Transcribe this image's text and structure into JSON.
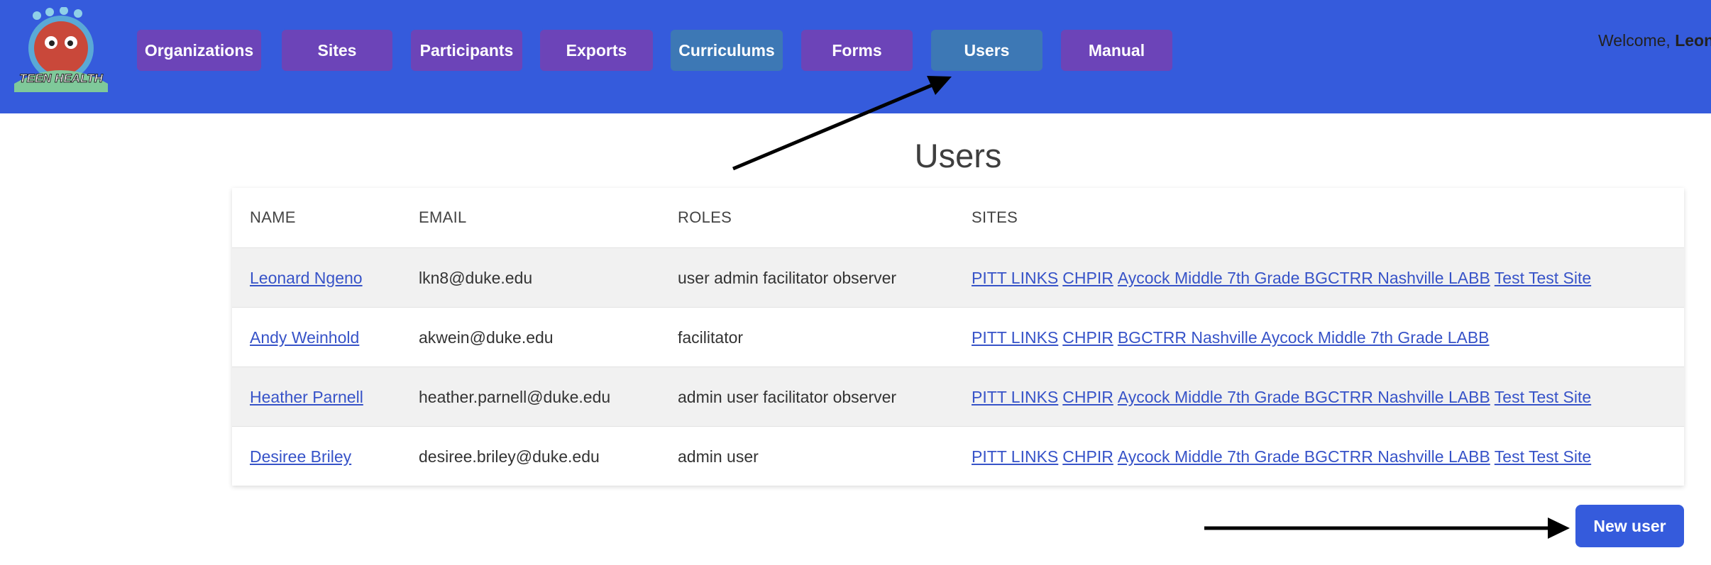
{
  "header": {
    "logo_text": "TEEN HEALTH",
    "nav": [
      {
        "label": "Organizations"
      },
      {
        "label": "Sites"
      },
      {
        "label": "Participants"
      },
      {
        "label": "Exports"
      },
      {
        "label": "Curriculums"
      },
      {
        "label": "Forms"
      },
      {
        "label": "Users",
        "active": true
      },
      {
        "label": "Manual"
      }
    ],
    "welcome_prefix": "Welcome, ",
    "welcome_name": "Leon"
  },
  "colors": {
    "header_bg": "#355bdc",
    "nav_bg": "#6c44b8",
    "nav_active_bg": "#3d78b5",
    "link": "#3753c8",
    "primary_button": "#355bdc"
  },
  "page": {
    "title": "Users"
  },
  "table": {
    "columns": [
      "NAME",
      "EMAIL",
      "ROLES",
      "SITES"
    ],
    "rows": [
      {
        "name": "Leonard Ngeno",
        "email": "lkn8@duke.edu",
        "roles": "user admin facilitator observer",
        "sites": [
          "PITT LINKS",
          "CHPIR",
          "Aycock Middle 7th Grade BGCTRR Nashville LABB",
          "Test Test Site"
        ]
      },
      {
        "name": "Andy Weinhold",
        "email": "akwein@duke.edu",
        "roles": "facilitator",
        "sites": [
          "PITT LINKS",
          "CHPIR",
          "BGCTRR Nashville Aycock Middle 7th Grade LABB"
        ]
      },
      {
        "name": "Heather Parnell",
        "email": "heather.parnell@duke.edu",
        "roles": "admin user facilitator observer",
        "sites": [
          "PITT LINKS",
          "CHPIR",
          "Aycock Middle 7th Grade BGCTRR Nashville LABB",
          "Test Test Site"
        ]
      },
      {
        "name": "Desiree Briley",
        "email": "desiree.briley@duke.edu",
        "roles": "admin user",
        "sites": [
          "PITT LINKS",
          "CHPIR",
          "Aycock Middle 7th Grade BGCTRR Nashville LABB",
          "Test Test Site"
        ]
      }
    ]
  },
  "actions": {
    "new_user": "New user"
  }
}
